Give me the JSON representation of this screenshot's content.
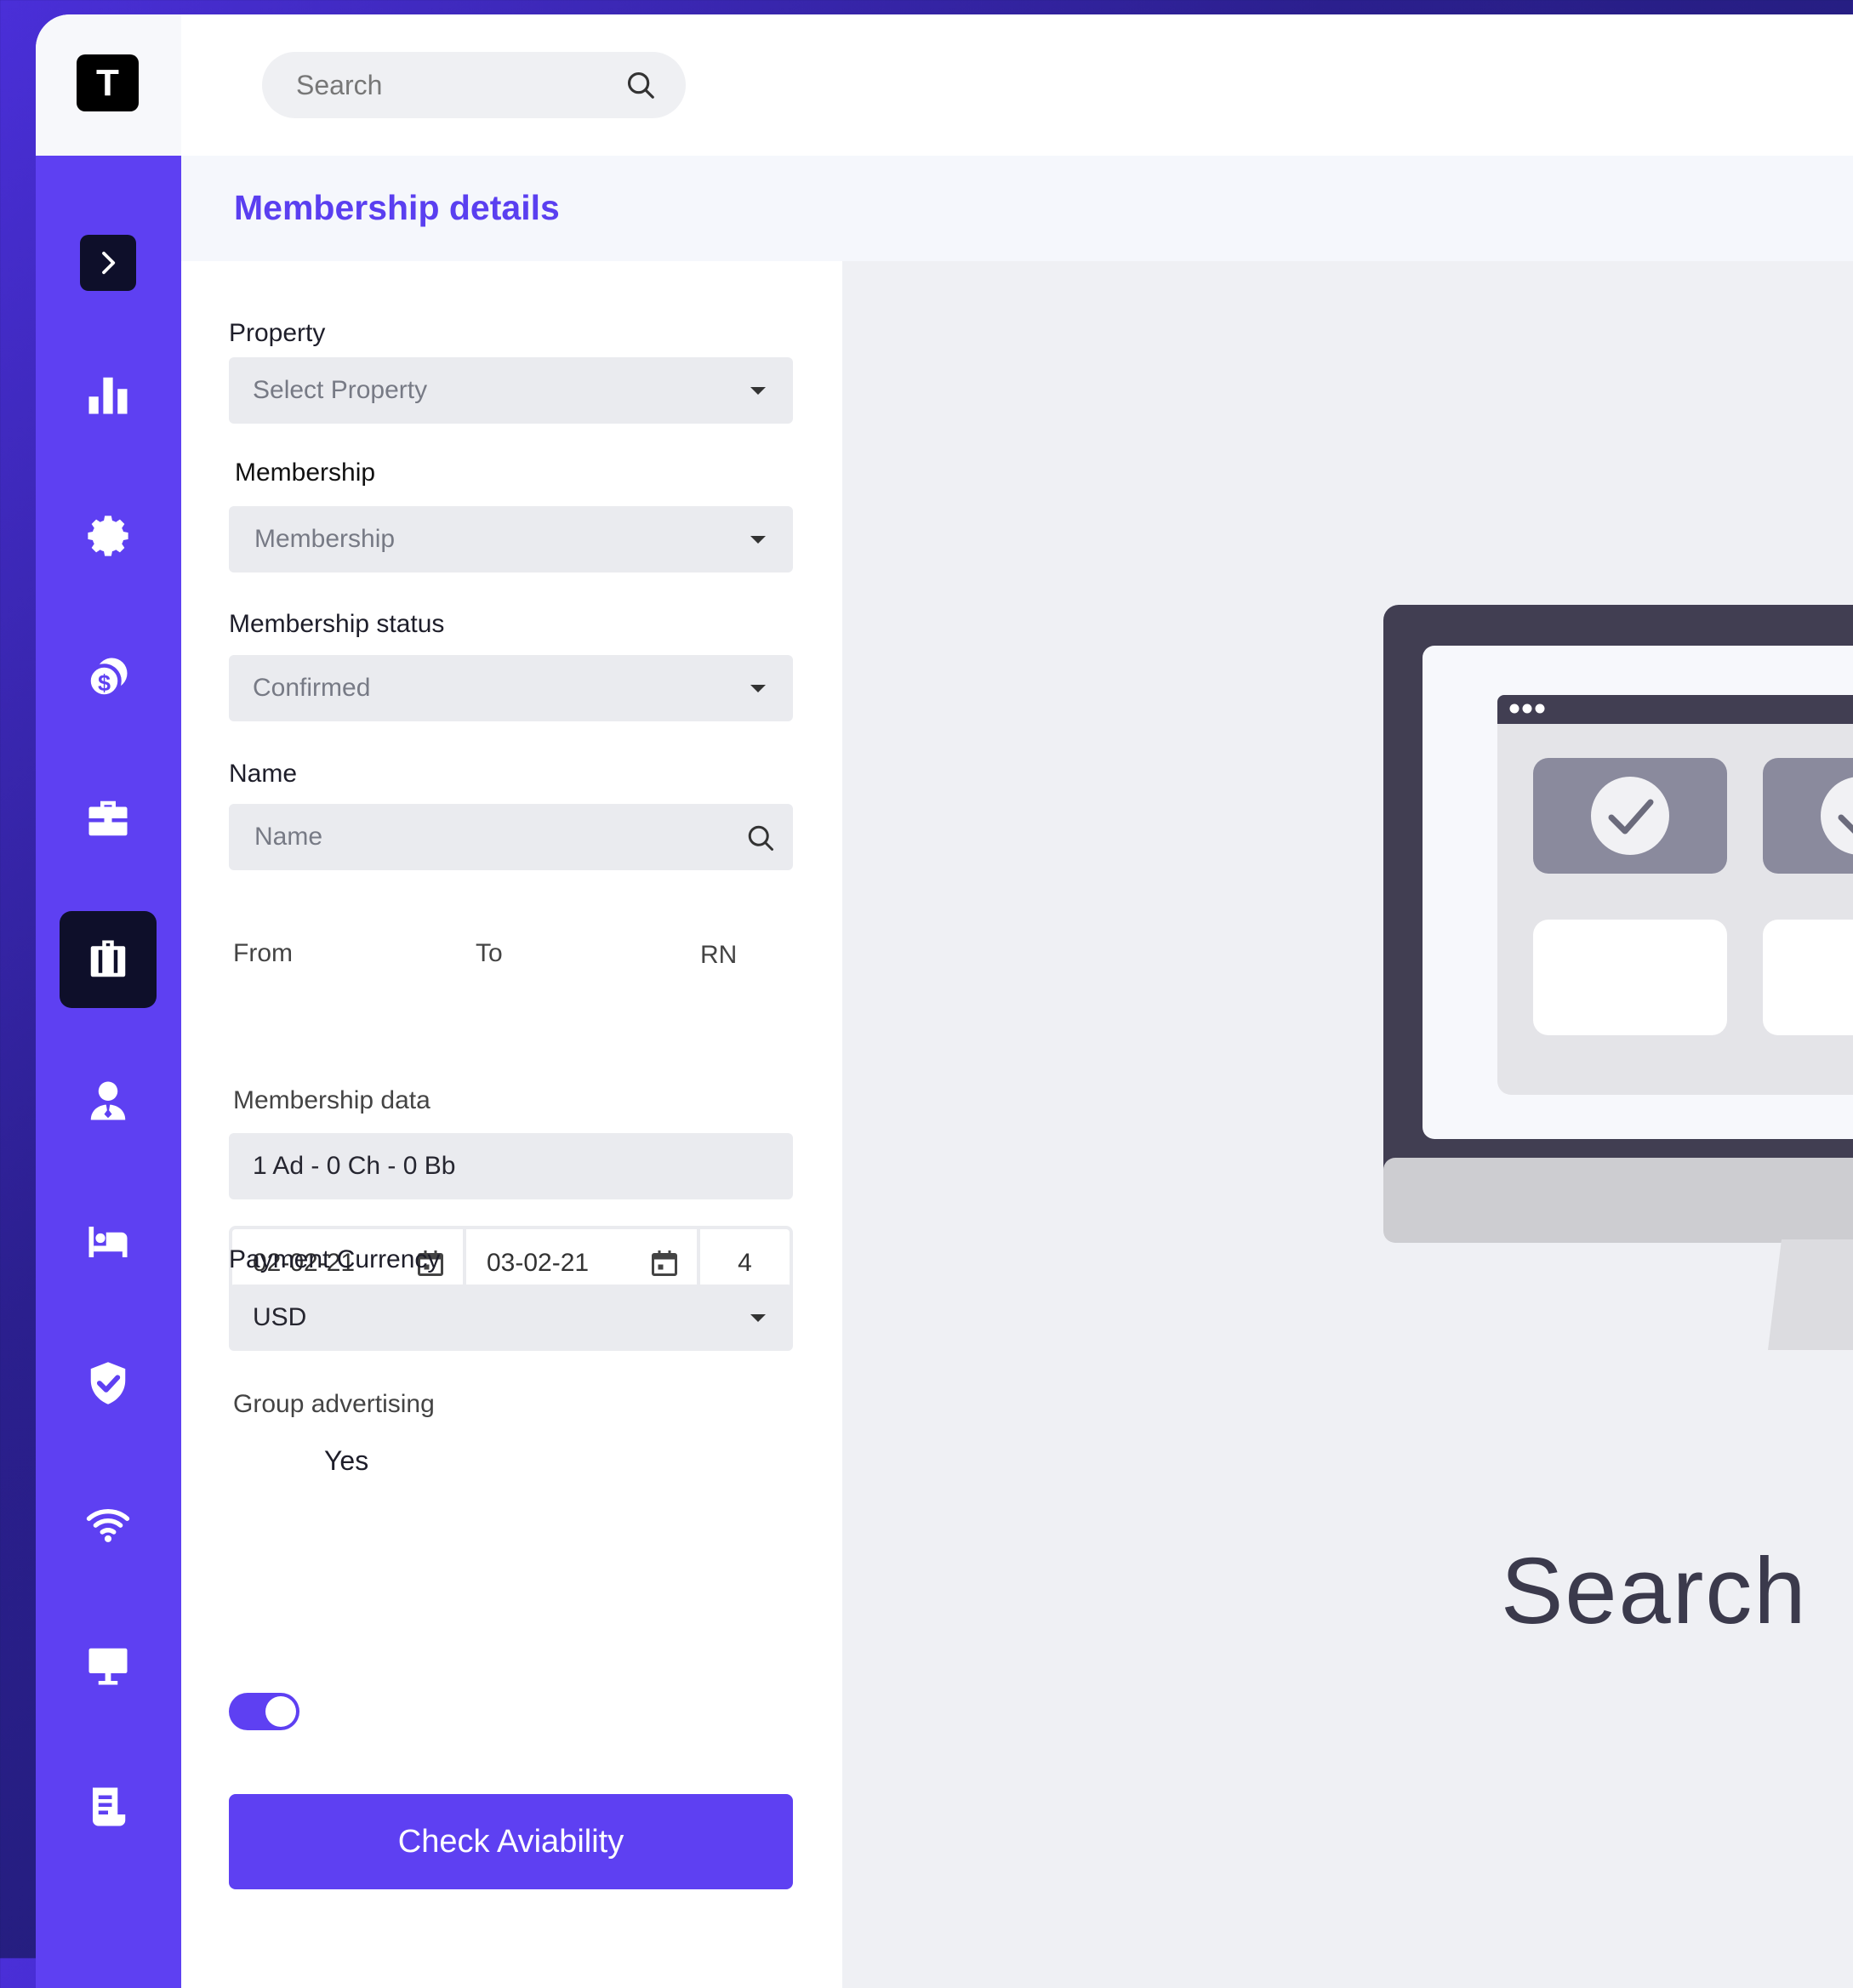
{
  "app": {
    "logo_letter": "T"
  },
  "search": {
    "placeholder": "Search"
  },
  "page": {
    "title": "Membership details"
  },
  "sidebar": {
    "items": [
      {
        "name": "bar-chart-icon"
      },
      {
        "name": "gear-icon"
      },
      {
        "name": "coins-icon"
      },
      {
        "name": "briefcase-icon"
      },
      {
        "name": "luggage-icon",
        "active": true
      },
      {
        "name": "user-icon"
      },
      {
        "name": "bed-icon"
      },
      {
        "name": "shield-check-icon"
      },
      {
        "name": "wifi-icon"
      },
      {
        "name": "monitor-icon"
      },
      {
        "name": "document-icon"
      }
    ]
  },
  "form": {
    "property": {
      "label": "Property",
      "value": "Select Property"
    },
    "membership": {
      "label": "Membership",
      "value": "Membership"
    },
    "status": {
      "label": "Membership status",
      "value": "Confirmed"
    },
    "name": {
      "label": "Name",
      "placeholder": "Name"
    },
    "from": {
      "label": "From",
      "value": "02-02-21"
    },
    "to": {
      "label": "To",
      "value": "03-02-21"
    },
    "rn": {
      "label": "RN",
      "value": "4"
    },
    "membership_data": {
      "label": "Membership data",
      "value": "1 Ad - 0 Ch - 0 Bb"
    },
    "currency": {
      "label": "Payment Currency",
      "value": "USD"
    },
    "group_advertising": {
      "label": "Group advertising",
      "toggle_label": "Yes",
      "on": true
    },
    "submit_label": "Check Aviability"
  },
  "preview": {
    "headline": "Search  A"
  },
  "colors": {
    "accent": "#5e40f2",
    "dark": "#0e0f2a",
    "title": "#5a3ff0"
  }
}
